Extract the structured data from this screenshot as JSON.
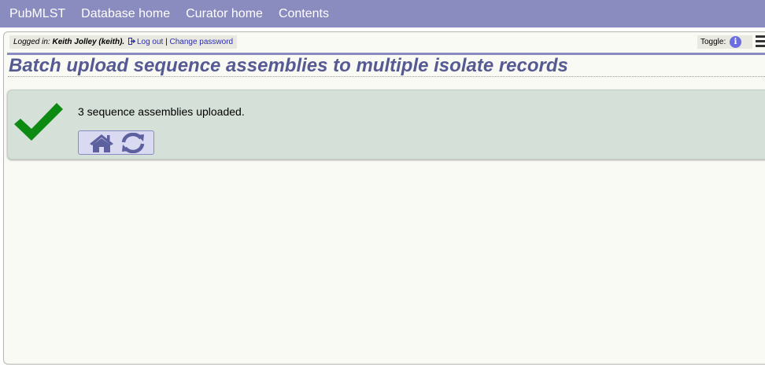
{
  "nav": {
    "items": [
      "PubMLST",
      "Database home",
      "Curator home",
      "Contents"
    ]
  },
  "login": {
    "prefix": "Logged in: ",
    "user": "Keith Jolley (keith).",
    "logout_label": "Log out",
    "separator": " | ",
    "change_password_label": "Change password"
  },
  "toggle": {
    "label": "Toggle:",
    "info_glyph": "i"
  },
  "page": {
    "title": "Batch upload sequence assemblies to multiple isolate records"
  },
  "result": {
    "message": "3 sequence assemblies uploaded."
  },
  "icons": {
    "tick": "check-icon",
    "home": "home-icon",
    "refresh": "refresh-icon",
    "logout": "sign-out-icon",
    "menu": "hamburger-menu-icon",
    "info": "info-circle-icon"
  },
  "colors": {
    "nav_bg": "#8a8bbf",
    "title": "#565a93",
    "success_bg": "#d5e0d8",
    "tick": "#0d8a12",
    "button_icon": "#5c609e"
  }
}
